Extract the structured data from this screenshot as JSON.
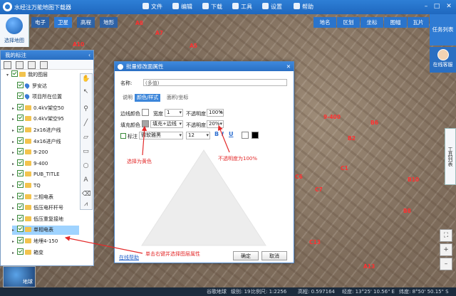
{
  "app": {
    "title": "水经注万能地图下载器"
  },
  "menu": [
    {
      "label": "文件",
      "icon": "folder-icon"
    },
    {
      "label": "编辑",
      "icon": "edit-icon"
    },
    {
      "label": "下载",
      "icon": "download-icon"
    },
    {
      "label": "工具",
      "icon": "toolbox-icon"
    },
    {
      "label": "设置",
      "icon": "gear-icon"
    },
    {
      "label": "帮助",
      "icon": "help-icon"
    }
  ],
  "logo_label": "选择地图",
  "left_tabs": [
    "电子",
    "卫星",
    "高程",
    "地形"
  ],
  "right_tabs": [
    "地名",
    "区划",
    "坐标",
    "图幅",
    "瓦片"
  ],
  "task_list": "任务列表",
  "online_help": "在线客服",
  "tools_list": "工具列表",
  "panel": {
    "title": "我的标注",
    "tree": [
      {
        "label": "我的图层",
        "kind": "folder",
        "level": 0,
        "twist": "▾"
      },
      {
        "label": "罗安达",
        "kind": "pin",
        "level": 1
      },
      {
        "label": "项目所在位置",
        "kind": "pin",
        "level": 1
      },
      {
        "label": "0.4kV架空50",
        "kind": "folder",
        "level": 1,
        "twist": "▸"
      },
      {
        "label": "0.4kV架空95",
        "kind": "folder",
        "level": 1,
        "twist": "▸"
      },
      {
        "label": "2x16进户线",
        "kind": "folder",
        "level": 1,
        "twist": "▸"
      },
      {
        "label": "4x16进户线",
        "kind": "folder",
        "level": 1,
        "twist": "▸"
      },
      {
        "label": "9-200",
        "kind": "folder",
        "level": 1,
        "twist": "▸"
      },
      {
        "label": "9-400",
        "kind": "folder",
        "level": 1,
        "twist": "▸"
      },
      {
        "label": "PUB_TITLE",
        "kind": "folder",
        "level": 1,
        "twist": "▸"
      },
      {
        "label": "TQ",
        "kind": "folder",
        "level": 1,
        "twist": "▸"
      },
      {
        "label": "三相电表",
        "kind": "folder",
        "level": 1,
        "twist": "▸"
      },
      {
        "label": "低压电杆杆号",
        "kind": "folder",
        "level": 1,
        "twist": "▸"
      },
      {
        "label": "低压重复接地",
        "kind": "folder",
        "level": 1,
        "twist": "▸"
      },
      {
        "label": "单相电表",
        "kind": "folder",
        "level": 1,
        "twist": "▸",
        "selected": true
      },
      {
        "label": "地埋4-150",
        "kind": "folder",
        "level": 1,
        "twist": "▸"
      },
      {
        "label": "箱变",
        "kind": "folder",
        "level": 1,
        "twist": "▸"
      }
    ]
  },
  "dialog": {
    "title": "批量修改面属性",
    "name_label": "名称:",
    "name_placeholder": "(多值)",
    "tabs": [
      "说明",
      "颜色/样式",
      "面积/坐标"
    ],
    "active_tab": 1,
    "border_color_label": "边线颜色",
    "width_label": "宽度",
    "width_value": "1",
    "opacity_label": "不透明度",
    "border_opacity": "100%",
    "fill_color_label": "填充颜色",
    "fill_mode": "填充+边线",
    "fill_opacity_label": "不透明度",
    "fill_opacity": "20%",
    "label_check": "标注",
    "font": "微软雅黑",
    "font_size": "12",
    "bold": "B",
    "italic": "I",
    "underline": "U",
    "help_link": "在线帮助",
    "ok": "确定",
    "cancel": "取消",
    "colors": {
      "border": "#ffffff",
      "fill": "#a6a6a6",
      "text_white": "#ffffff",
      "text_black": "#000000"
    }
  },
  "annotations": {
    "gray": "选择为黄色",
    "opacity": "不透明度为100%",
    "rightclick": "单击右键并选择图层属性"
  },
  "map_labels": [
    "A8",
    "A7",
    "A5",
    "A4",
    "A10",
    "B10",
    "C7",
    "C6",
    "C1",
    "A13",
    "B2",
    "B6",
    "C13",
    "9-400",
    "B8"
  ],
  "minimap_label": "地球",
  "status": {
    "s1": "谷歌地球",
    "s2": "级别: 19",
    "s3": "比例尺: 1:2256",
    "s4": "经度: 13°25' 10.56\" E",
    "s5": "纬度: 8°50' 50.15\" S",
    "s6": "高程: 0.597164"
  }
}
